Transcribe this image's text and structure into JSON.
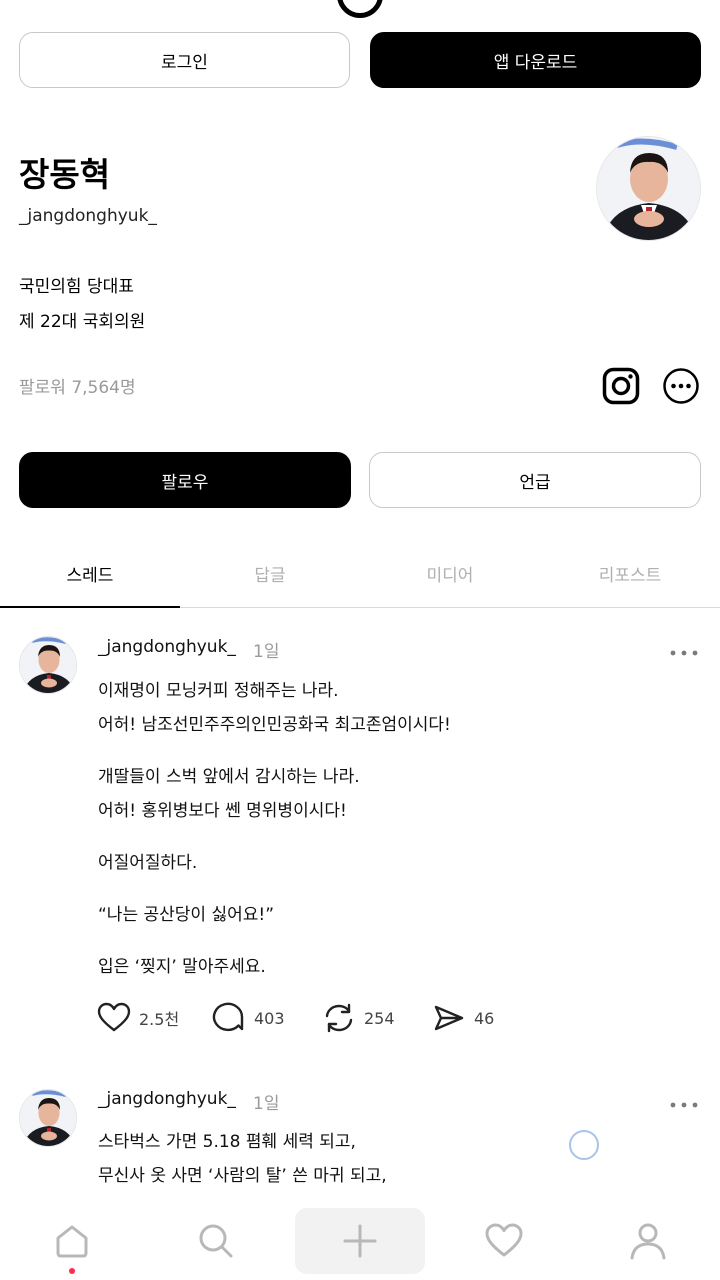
{
  "header": {
    "login_label": "로그인",
    "download_label": "앱 다운로드"
  },
  "profile": {
    "name": "장동혁",
    "handle": "_jangdonghyuk_",
    "bio_line1": "국민의힘 당대표",
    "bio_line2": "제 22대 국회의원",
    "followers": "팔로워 7,564명",
    "follow_label": "팔로우",
    "mention_label": "언급"
  },
  "tabs": [
    {
      "label": "스레드"
    },
    {
      "label": "답글"
    },
    {
      "label": "미디어"
    },
    {
      "label": "리포스트"
    }
  ],
  "posts": [
    {
      "author": "_jangdonghyuk_",
      "time": "1일",
      "lines": [
        "이재명이 모닝커피 정해주는 나라.",
        "어허! 남조선민주주의인민공화국 최고존엄이시다!",
        "개딸들이 스벅 앞에서 감시하는 나라.",
        "어허! 홍위병보다 쎈 명위병이시다!",
        "어질어질하다.",
        "“나는 공산당이 싫어요!”",
        "입은 ‘찢지’ 말아주세요."
      ],
      "likes": "2.5천",
      "replies": "403",
      "reposts": "254",
      "shares": "46"
    },
    {
      "author": "_jangdonghyuk_",
      "time": "1일",
      "lines": [
        "스타벅스 가면 5.18 폄훼 세력 되고,",
        "무신사 옷 사면 ‘사람의 탈’ 쓴 마귀 되고,"
      ]
    }
  ],
  "nav": {
    "items": [
      "home-icon",
      "search-icon",
      "plus-icon",
      "heart-icon",
      "profile-icon"
    ]
  },
  "colors": {
    "accent_dot": "#ff2a4b",
    "muted": "#9a9a9a"
  }
}
